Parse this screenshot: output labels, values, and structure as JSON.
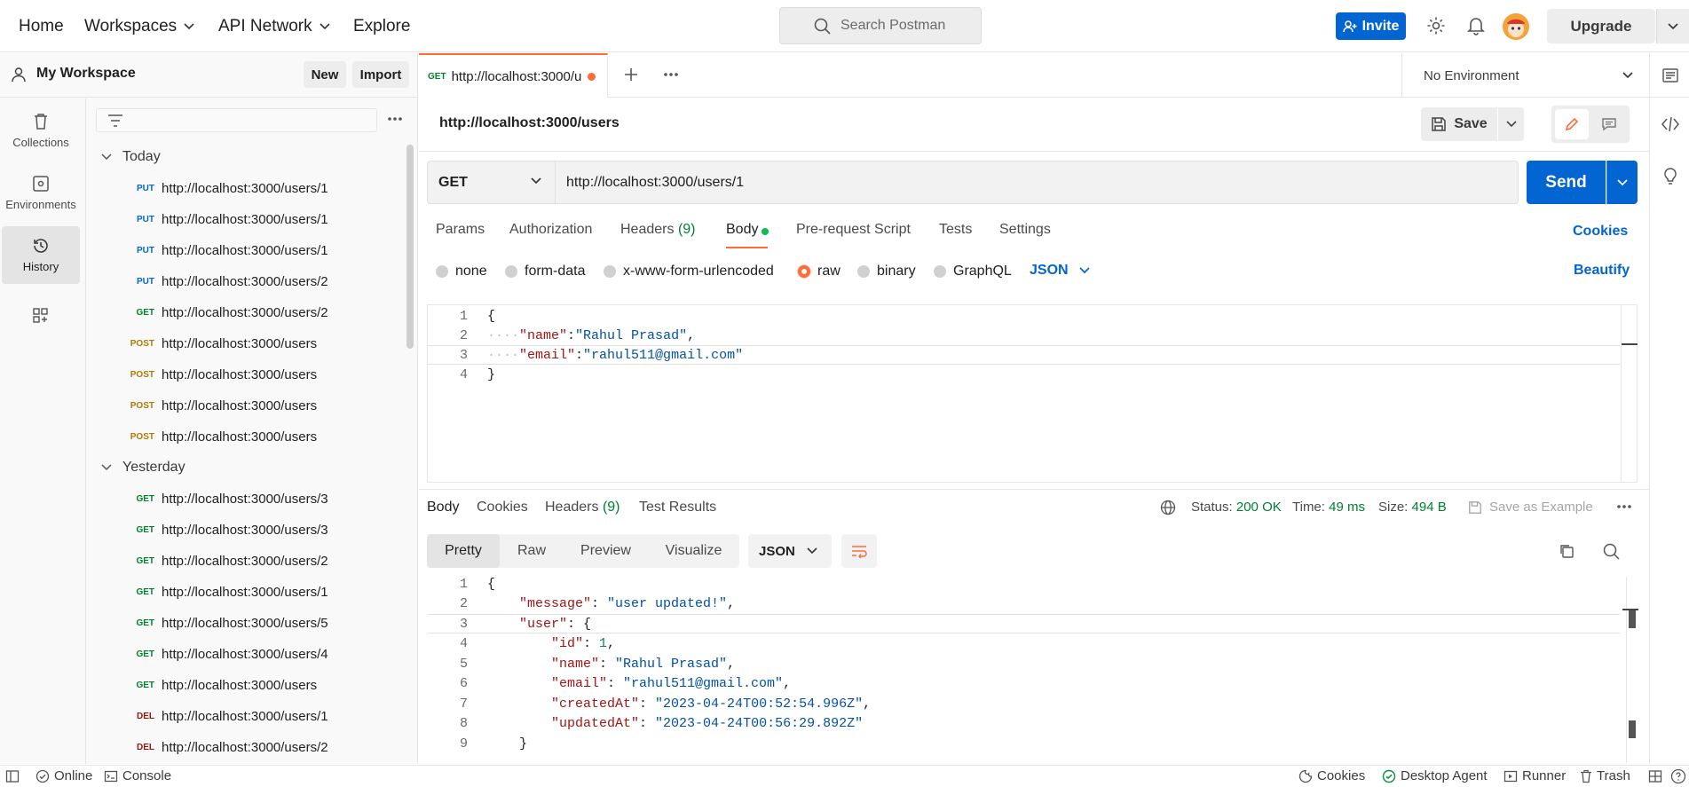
{
  "nav": {
    "home": "Home",
    "workspaces": "Workspaces",
    "api_network": "API Network",
    "explore": "Explore",
    "search_placeholder": "Search Postman",
    "invite": "Invite",
    "upgrade": "Upgrade"
  },
  "workspace": {
    "title": "My Workspace",
    "new_label": "New",
    "import_label": "Import"
  },
  "rail": {
    "collections": "Collections",
    "environments": "Environments",
    "history": "History"
  },
  "history": {
    "today_label": "Today",
    "yesterday_label": "Yesterday",
    "today": [
      {
        "method": "PUT",
        "url": "http://localhost:3000/users/1"
      },
      {
        "method": "PUT",
        "url": "http://localhost:3000/users/1"
      },
      {
        "method": "PUT",
        "url": "http://localhost:3000/users/1"
      },
      {
        "method": "PUT",
        "url": "http://localhost:3000/users/2"
      },
      {
        "method": "GET",
        "url": "http://localhost:3000/users/2"
      },
      {
        "method": "POST",
        "url": "http://localhost:3000/users"
      },
      {
        "method": "POST",
        "url": "http://localhost:3000/users"
      },
      {
        "method": "POST",
        "url": "http://localhost:3000/users"
      },
      {
        "method": "POST",
        "url": "http://localhost:3000/users"
      }
    ],
    "yesterday": [
      {
        "method": "GET",
        "url": "http://localhost:3000/users/3"
      },
      {
        "method": "GET",
        "url": "http://localhost:3000/users/3"
      },
      {
        "method": "GET",
        "url": "http://localhost:3000/users/2"
      },
      {
        "method": "GET",
        "url": "http://localhost:3000/users/1"
      },
      {
        "method": "GET",
        "url": "http://localhost:3000/users/5"
      },
      {
        "method": "GET",
        "url": "http://localhost:3000/users/4"
      },
      {
        "method": "GET",
        "url": "http://localhost:3000/users"
      },
      {
        "method": "DEL",
        "url": "http://localhost:3000/users/1"
      },
      {
        "method": "DEL",
        "url": "http://localhost:3000/users/2"
      }
    ]
  },
  "tab": {
    "method": "GET",
    "title": "http://localhost:3000/u"
  },
  "environment": "No Environment",
  "request": {
    "title": "http://localhost:3000/users",
    "save_label": "Save",
    "method": "GET",
    "url": "http://localhost:3000/users/1",
    "send_label": "Send",
    "tabs": {
      "params": "Params",
      "authorization": "Authorization",
      "headers": "Headers",
      "headers_count": "(9)",
      "body": "Body",
      "pre_request": "Pre-request Script",
      "tests": "Tests",
      "settings": "Settings"
    },
    "cookies_label": "Cookies",
    "beautify_label": "Beautify",
    "body_types": [
      "none",
      "form-data",
      "x-www-form-urlencoded",
      "raw",
      "binary",
      "GraphQL"
    ],
    "body_type_selected": "raw",
    "body_format": "JSON",
    "body_lines": [
      {
        "n": "1",
        "text": "{"
      },
      {
        "n": "2",
        "key": "\"name\"",
        "val": "\"Rahul Prasad\"",
        "tail": ","
      },
      {
        "n": "3",
        "key": "\"email\"",
        "val": "\"rahul511@gmail.com\"",
        "tail": ""
      },
      {
        "n": "4",
        "text": "}"
      }
    ]
  },
  "response": {
    "tabs": {
      "body": "Body",
      "cookies": "Cookies",
      "headers": "Headers",
      "headers_count": "(9)",
      "test_results": "Test Results"
    },
    "status_label": "Status:",
    "status_value": "200 OK",
    "time_label": "Time:",
    "time_value": "49 ms",
    "size_label": "Size:",
    "size_value": "494 B",
    "save_example": "Save as Example",
    "views": [
      "Pretty",
      "Raw",
      "Preview",
      "Visualize"
    ],
    "view_selected": "Pretty",
    "format": "JSON",
    "lines": [
      {
        "n": "1",
        "indent": 0,
        "text": "{"
      },
      {
        "n": "2",
        "indent": 1,
        "key": "\"message\"",
        "val": "\"user updated!\"",
        "tail": ","
      },
      {
        "n": "3",
        "indent": 1,
        "key": "\"user\"",
        "open": "{"
      },
      {
        "n": "4",
        "indent": 2,
        "key": "\"id\"",
        "num": "1",
        "tail": ","
      },
      {
        "n": "5",
        "indent": 2,
        "key": "\"name\"",
        "val": "\"Rahul Prasad\"",
        "tail": ","
      },
      {
        "n": "6",
        "indent": 2,
        "key": "\"email\"",
        "val": "\"rahul511@gmail.com\"",
        "tail": ","
      },
      {
        "n": "7",
        "indent": 2,
        "key": "\"createdAt\"",
        "val": "\"2023-04-24T00:52:54.996Z\"",
        "tail": ","
      },
      {
        "n": "8",
        "indent": 2,
        "key": "\"updatedAt\"",
        "val": "\"2023-04-24T00:56:29.892Z\"",
        "tail": ""
      },
      {
        "n": "9",
        "indent": 1,
        "text": "}"
      }
    ]
  },
  "statusbar": {
    "online": "Online",
    "console": "Console",
    "cookies": "Cookies",
    "desktop_agent": "Desktop Agent",
    "runner": "Runner",
    "trash": "Trash"
  },
  "colors": {
    "accent_orange": "#ff6c37",
    "primary_blue": "#0265d2",
    "put": "#0265d2",
    "get": "#007f31",
    "post": "#ad7a03",
    "del": "#8e1a10"
  }
}
